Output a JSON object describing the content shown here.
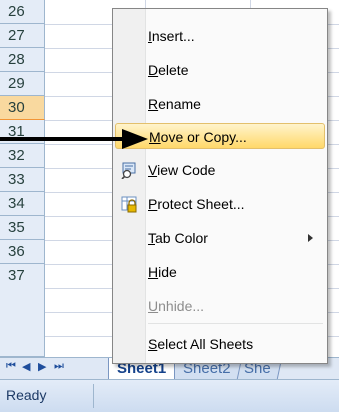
{
  "rows": [
    "26",
    "27",
    "28",
    "29",
    "30",
    "31",
    "32",
    "33",
    "34",
    "35",
    "36",
    "37"
  ],
  "active_row": "30",
  "sheet_tabs": {
    "nav_glyphs": [
      "⏮",
      "◀",
      "▶",
      "⏭"
    ],
    "tabs": [
      "Sheet1",
      "Sheet2",
      "She"
    ],
    "active": "Sheet1"
  },
  "status": {
    "text": "Ready"
  },
  "context_menu": {
    "items": [
      {
        "pre": "",
        "u": "I",
        "post": "nsert...",
        "icon": "",
        "disabled": false,
        "hover": false,
        "submenu": false
      },
      {
        "pre": "",
        "u": "D",
        "post": "elete",
        "icon": "",
        "disabled": false,
        "hover": false,
        "submenu": false
      },
      {
        "pre": "",
        "u": "R",
        "post": "ename",
        "icon": "",
        "disabled": false,
        "hover": false,
        "submenu": false
      },
      {
        "pre": "",
        "u": "M",
        "post": "ove or Copy...",
        "icon": "",
        "disabled": false,
        "hover": true,
        "submenu": false
      },
      {
        "pre": "",
        "u": "V",
        "post": "iew Code",
        "icon": "view-code-icon",
        "disabled": false,
        "hover": false,
        "submenu": false
      },
      {
        "pre": "",
        "u": "P",
        "post": "rotect Sheet...",
        "icon": "protect-sheet-icon",
        "disabled": false,
        "hover": false,
        "submenu": false
      },
      {
        "pre": "",
        "u": "T",
        "post": "ab Color",
        "icon": "",
        "disabled": false,
        "hover": false,
        "submenu": true
      },
      {
        "pre": "",
        "u": "H",
        "post": "ide",
        "icon": "",
        "disabled": false,
        "hover": false,
        "submenu": false
      },
      {
        "pre": "",
        "u": "U",
        "post": "nhide...",
        "icon": "",
        "disabled": true,
        "hover": false,
        "submenu": false
      },
      {
        "pre": "",
        "u": "S",
        "post": "elect All Sheets",
        "icon": "",
        "disabled": false,
        "hover": false,
        "submenu": false
      }
    ]
  },
  "annotation": {
    "icon": "pointer-arrow-icon",
    "color": "#000000"
  }
}
